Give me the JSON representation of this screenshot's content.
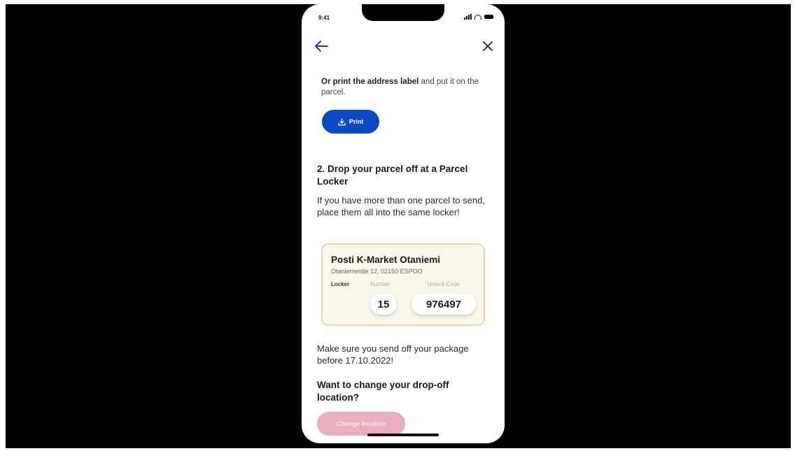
{
  "status_bar": {
    "time": "9:41"
  },
  "icons": {
    "back": "arrow-left-icon",
    "close": "close-icon",
    "download": "download-icon"
  },
  "print_section": {
    "text_bold": "Or print the address label",
    "text_rest": " and put it on the parcel.",
    "button_label": "Print"
  },
  "step2": {
    "heading": "2. Drop your parcel off at a Parcel Locker",
    "description": "If you have more than one parcel to send, place them all into the same locker!"
  },
  "locker": {
    "name": "Posti K-Market Otaniemi",
    "address": "Otaniementie 12, 02150 ESPOO",
    "locker_label": "Locker",
    "number_label": "Number",
    "code_label": "Unlock Code",
    "number": "15",
    "code": "976497"
  },
  "deadline_text": "Make sure you send off your package before 17.10.2022!",
  "change_section": {
    "heading": "Want to change your drop-off location?",
    "button_label": "Change location"
  },
  "colors": {
    "primary_blue": "#0a49c2",
    "card_bg": "#fbf6ea",
    "card_border": "#ecd9a8",
    "pink_button": "#e8aebd"
  }
}
